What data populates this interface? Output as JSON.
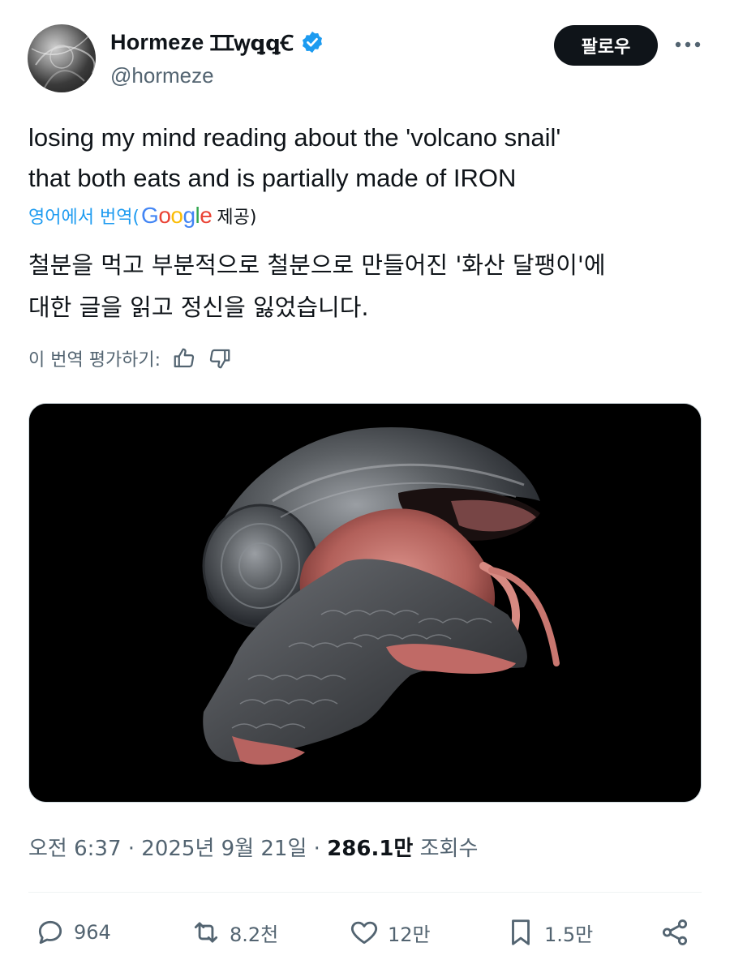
{
  "author": {
    "display_name": "Hormeze",
    "name_glyphs": "ꞮꞮꝡꝗꝗꞒ",
    "handle": "@hormeze",
    "verified": true
  },
  "header": {
    "follow_label": "팔로우",
    "more_icon": "more-horizontal-icon"
  },
  "tweet": {
    "text_line1": "losing my mind reading about the 'volcano snail'",
    "text_line2": "that both eats and is partially made of IRON"
  },
  "translation": {
    "link_label": "영어에서 번역(",
    "provider": "Google",
    "provided_label": "제공)",
    "text_line1": "철분을 먹고 부분적으로 철분으로 만들어진 '화산 달팽이'에",
    "text_line2": "대한 글을 읽고 정신을 잃었습니다.",
    "rate_label": "이 번역 평가하기:"
  },
  "meta": {
    "time": "오전 6:37",
    "date": "2025년 9월 21일",
    "views": "286.1만",
    "views_label": "조회수",
    "separator": "·"
  },
  "actions": {
    "replies": "964",
    "reposts": "8.2천",
    "likes": "12만",
    "bookmarks": "1.5만"
  },
  "colors": {
    "text": "#0f1419",
    "secondary": "#536471",
    "accent": "#1d9bf0",
    "follow_bg": "#0f1419",
    "verified": "#1d9bf0"
  }
}
